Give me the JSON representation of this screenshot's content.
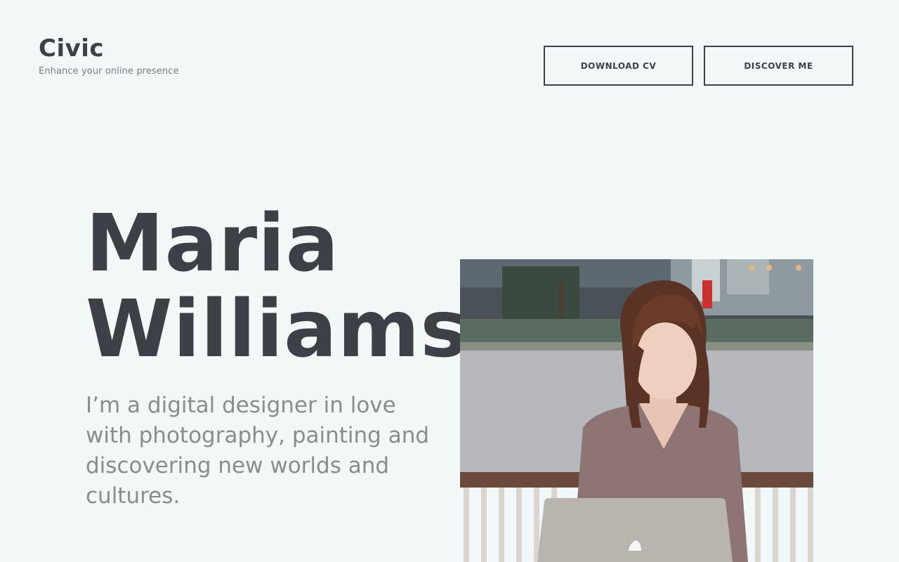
{
  "brand": {
    "title": "Civic",
    "tagline": "Enhance your online presence"
  },
  "nav": {
    "download_cv_label": "DOWNLOAD CV",
    "discover_me_label": "DISCOVER ME"
  },
  "hero": {
    "first_name": "Maria",
    "last_name": "Williams",
    "bio": "I’m a digital designer in love with photography, painting and discovering new worlds and cultures."
  },
  "colors": {
    "background": "#f2f7f7",
    "text_dark": "#3d4047",
    "text_muted": "#8a8c90"
  }
}
